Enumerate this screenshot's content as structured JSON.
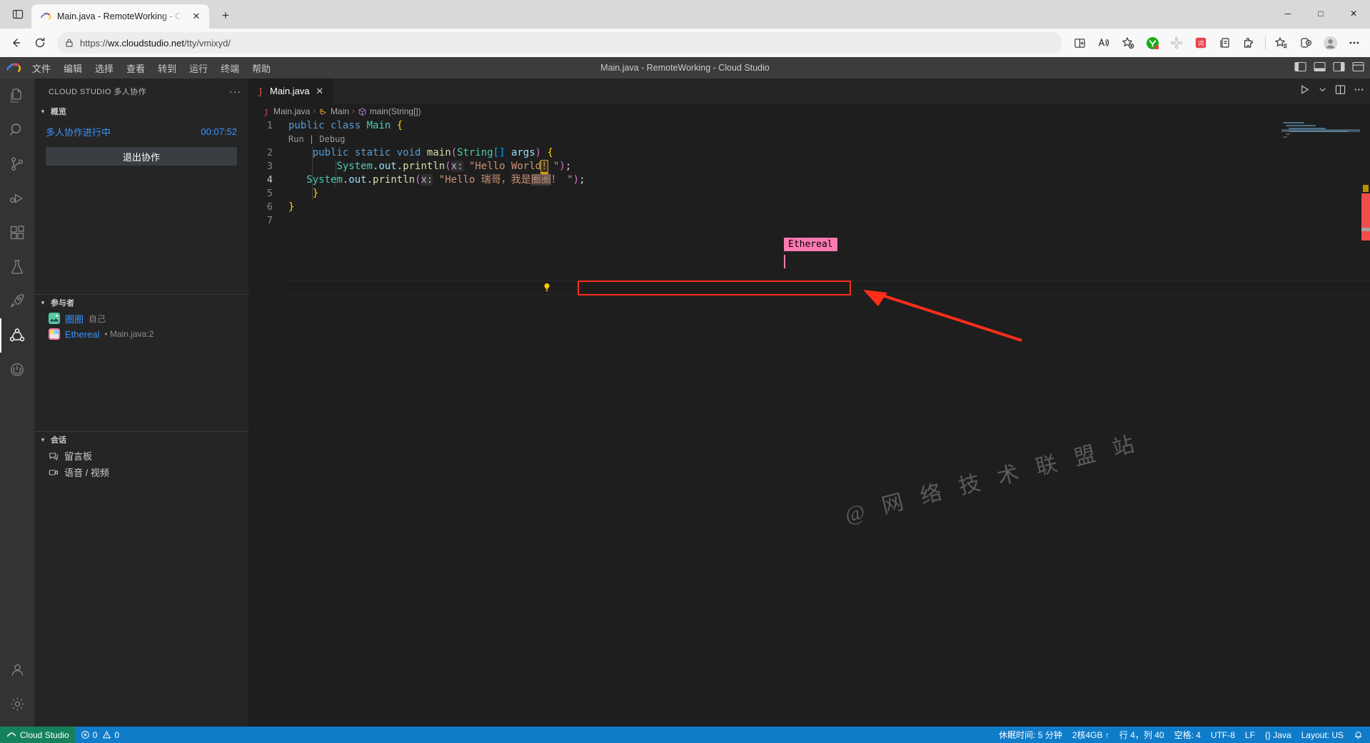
{
  "browser": {
    "tab": {
      "title": "Main.java - RemoteWorking - Cl",
      "favicon_name": "cloud-studio-favicon",
      "close_label": "✕"
    },
    "new_tab_label": "+",
    "tab_list_icon": "tab-list-icon",
    "window_controls": {
      "minimize": "─",
      "maximize": "□",
      "close": "✕"
    },
    "nav": {
      "back": "←",
      "reload": "⟳"
    },
    "omnibox": {
      "lock_icon": "lock-icon",
      "url_prefix": "https://",
      "url_host": "wx.cloudstudio.net",
      "url_path": "/tty/vmixyd/",
      "url_full": "https://wx.cloudstudio.net/tty/vmixyd/"
    },
    "toolbar_right_icons": [
      "split-screen-icon",
      "read-aloud-icon",
      "add-favorite-icon",
      "youdao-extension-icon",
      "extension-gray-icon",
      "red-extension-icon",
      "collections-icon",
      "extensions-puzzle-icon",
      "favorites-icon",
      "add-tab-group-icon",
      "profile-avatar-icon",
      "settings-more-icon"
    ]
  },
  "vscode": {
    "logo_name": "cloud-studio-logo",
    "menu": [
      "文件",
      "编辑",
      "选择",
      "查看",
      "转到",
      "运行",
      "终端",
      "帮助"
    ],
    "window_title": "Main.java - RemoteWorking - Cloud Studio",
    "layout_controls": [
      "toggle-primary-sidebar-icon",
      "toggle-panel-icon",
      "toggle-secondary-sidebar-icon",
      "customize-layout-icon"
    ],
    "activitybar": [
      {
        "name": "explorer",
        "icon": "files-icon",
        "active": false
      },
      {
        "name": "search",
        "icon": "search-icon",
        "active": false
      },
      {
        "name": "source-control",
        "icon": "source-control-icon",
        "active": false
      },
      {
        "name": "run-and-debug",
        "icon": "debug-icon",
        "active": false
      },
      {
        "name": "extensions",
        "icon": "extensions-icon",
        "active": false
      },
      {
        "name": "testing",
        "icon": "beaker-icon",
        "active": false
      },
      {
        "name": "deploy",
        "icon": "rocket-icon",
        "active": false
      },
      {
        "name": "collaboration",
        "icon": "collaboration-icon",
        "active": true
      }
    ],
    "activitybar_bottom": [
      {
        "name": "power",
        "icon": "power-icon"
      },
      {
        "name": "accounts",
        "icon": "account-icon"
      },
      {
        "name": "manage",
        "icon": "gear-icon"
      }
    ],
    "sidebar": {
      "title": "CLOUD STUDIO 多人协作",
      "more_actions": "···",
      "overview": {
        "section_label": "概览",
        "status_text": "多人协作进行中",
        "timer": "00:07:52",
        "quit_button": "退出协作"
      },
      "participants": {
        "section_label": "参与者",
        "items": [
          {
            "name": "圈圈",
            "meta": "自己",
            "avatar_color": "#4ec9b0",
            "avatar_name": "avatar-quanquan"
          },
          {
            "name": "Ethereal",
            "meta": "• Main.java:2",
            "avatar_color": "#ff7ab2",
            "avatar_name": "avatar-ethereal"
          }
        ]
      },
      "session": {
        "section_label": "会话",
        "items": [
          {
            "label": "留言板",
            "icon": "comment-icon"
          },
          {
            "label": "语音 / 视频",
            "icon": "video-icon"
          }
        ]
      }
    },
    "editor": {
      "tab": {
        "label": "Main.java",
        "icon": "java-file-icon",
        "close": "✕"
      },
      "tab_actions": [
        "run-icon",
        "chevron-down-icon",
        "split-editor-icon",
        "more-actions-icon"
      ],
      "breadcrumbs": [
        {
          "label": "Main.java",
          "icon": "java-file-icon"
        },
        {
          "label": "Main",
          "icon": "class-icon"
        },
        {
          "label": "main(String[])",
          "icon": "method-icon"
        }
      ],
      "breadcrumb_separator": "›",
      "codelens": {
        "run": "Run",
        "sep": "|",
        "debug": "Debug"
      },
      "remote_cursor_label": "Ethereal",
      "lightbulb_icon": "lightbulb-icon",
      "lines": [
        {
          "no": "1",
          "text": "public class Main {"
        },
        {
          "no": "2",
          "text": "    public static void main(String[] args) {"
        },
        {
          "no": "3",
          "text": "        System.out.println(x: \"Hello World! \");"
        },
        {
          "no": "4",
          "text": "        System.out.println(x: \"Hello 瑞哥，我是圈圈！ \");"
        },
        {
          "no": "5",
          "text": "    }"
        },
        {
          "no": "6",
          "text": "}"
        },
        {
          "no": "7",
          "text": ""
        }
      ],
      "strings": {
        "line3_literal": "\"Hello World! \"",
        "line4_literal_prefix": "\"Hello 瑞哥，我是",
        "line4_literal_selected": "圈圈",
        "line4_literal_suffix": "！ \"",
        "param_hint": "x:"
      },
      "watermark": "@ 网 络 技 术 联 盟 站"
    },
    "statusbar": {
      "remote": {
        "label": "Cloud Studio",
        "icon": "remote-icon"
      },
      "problems": {
        "errors": "0",
        "warnings": "0",
        "error_icon": "error-circle-icon",
        "warning_icon": "warning-triangle-icon"
      },
      "right_items": [
        {
          "name": "idle-time",
          "label": "休眠时间: 5 分钟"
        },
        {
          "name": "machine-spec",
          "label": "2核4GB ↑"
        },
        {
          "name": "cursor-position",
          "label": "行 4，列 40"
        },
        {
          "name": "indentation",
          "label": "空格: 4"
        },
        {
          "name": "encoding",
          "label": "UTF-8"
        },
        {
          "name": "eol",
          "label": "LF"
        },
        {
          "name": "language-mode",
          "label": "{} Java"
        },
        {
          "name": "keyboard-layout",
          "label": "Layout: US"
        },
        {
          "name": "notifications",
          "label": "🔔"
        }
      ]
    }
  },
  "colors": {
    "accent_blue": "#0f7cc9",
    "remote_green": "#16825d",
    "cursor_pink": "#ff7ab2",
    "annotation_red": "#ff2d1a",
    "editor_bg": "#1e1e1e",
    "sidebar_bg": "#252526",
    "activitybar_bg": "#333333",
    "titlebar_bg": "#3c3c3c"
  }
}
